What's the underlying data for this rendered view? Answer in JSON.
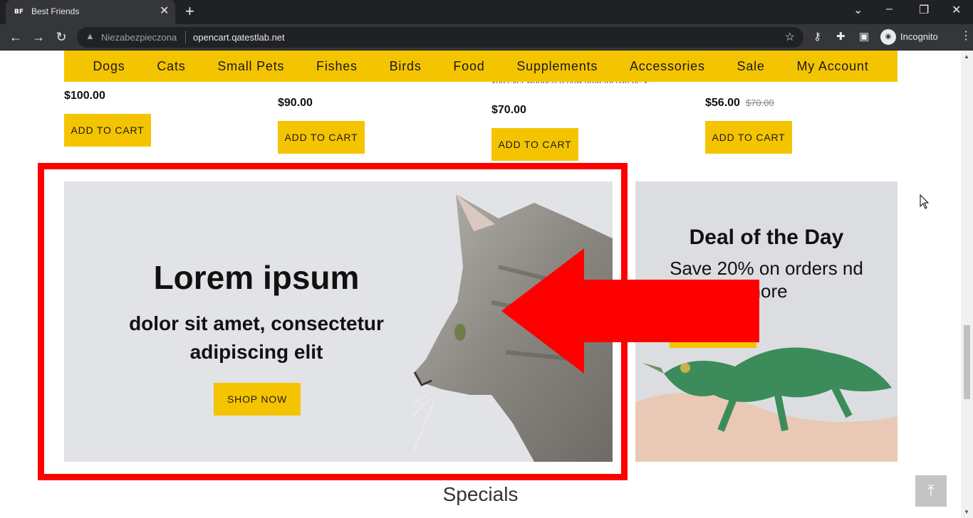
{
  "browser": {
    "tab_title": "Best Friends",
    "tab_favicon": "BF",
    "security_label": "Niezabezpieczona",
    "url": "opencart.qatestlab.net",
    "profile_label": "Incognito"
  },
  "nav": {
    "items": [
      "Dogs",
      "Cats",
      "Small Pets",
      "Fishes",
      "Birds",
      "Food",
      "Supplements",
      "Accessories",
      "Sale",
      "My Account"
    ]
  },
  "products": [
    {
      "price": "$100.00",
      "old_price": "",
      "button": "ADD TO CART"
    },
    {
      "price": "$90.00",
      "old_price": "",
      "button": "ADD TO CART"
    },
    {
      "price": "$70.00",
      "old_price": "",
      "button": "ADD TO CART"
    },
    {
      "price": "$56.00",
      "old_price": "$70.00",
      "button": "ADD TO CART"
    }
  ],
  "banner": {
    "title": "Lorem ipsum",
    "subtitle": "dolor sit amet, consectetur adipiscing elit",
    "button": "SHOP NOW"
  },
  "deal": {
    "title": "Deal of the Day",
    "subtitle": "Save 20% on orders nd more"
  },
  "section_title": "Specials",
  "colors": {
    "accent": "#f5c400",
    "annotation": "#ff0000"
  },
  "icons": [
    "warning-icon",
    "star-icon",
    "extensions-icon",
    "sidebar-icon",
    "back-to-top-icon",
    "mouse-cursor-icon"
  ]
}
